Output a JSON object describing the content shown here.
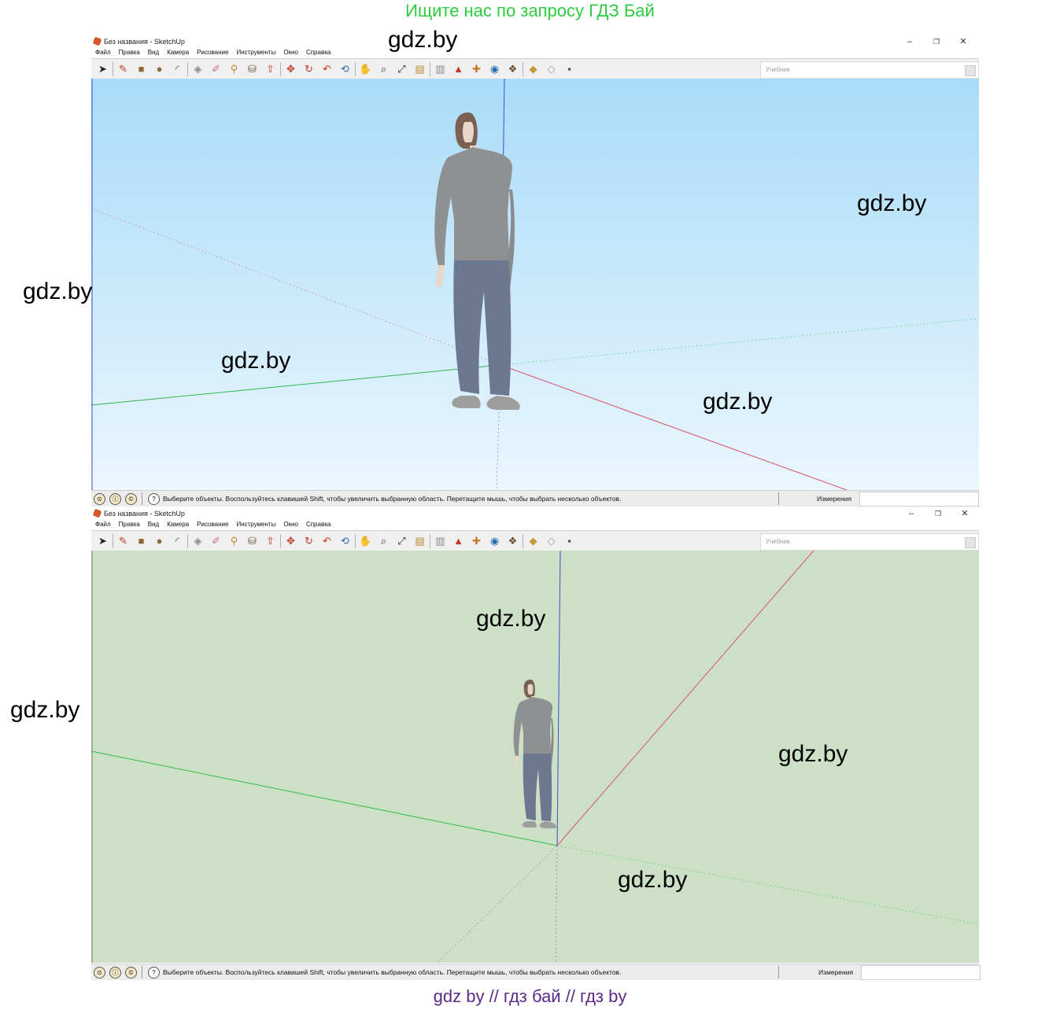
{
  "banner_top": "Ищите нас по запросу ГДЗ Бай",
  "banner_bottom": "gdz by  //  гдз бай  //  гдз by",
  "watermark": "gdz.by",
  "windows": [
    {
      "title": "Без названия - SketchUp",
      "menu": [
        "Файл",
        "Правка",
        "Вид",
        "Камера",
        "Рисование",
        "Инструменты",
        "Окно",
        "Справка"
      ],
      "search_placeholder": "Учебник",
      "status_text": "Выберите объекты. Воспользуйтесь клавишей Shift, чтобы увеличить выбранную область. Перетащите мышь, чтобы выбрать несколько объектов.",
      "measurements_label": "Измерения",
      "viewport_style": "sky-gradient"
    },
    {
      "title": "Без названия - SketchUp",
      "menu": [
        "Файл",
        "Правка",
        "Вид",
        "Камера",
        "Рисование",
        "Инструменты",
        "Окно",
        "Справка"
      ],
      "search_placeholder": "Учебник",
      "status_text": "Выберите объекты. Воспользуйтесь клавишей Shift, чтобы увеличить выбранную область. Перетащите мышь, чтобы выбрать несколько объектов.",
      "measurements_label": "Измерения",
      "viewport_style": "flat-green"
    }
  ],
  "window_controls": [
    "–",
    "❐",
    "✕"
  ],
  "colors": {
    "sky_top": "#a8dcf8",
    "sky_bottom": "#eaf7fe",
    "ground_green": "#cce0c6",
    "axis_red": "#d9536a",
    "axis_green": "#2fb84a",
    "axis_blue": "#3a4fcf",
    "banner_green": "#2ecc40",
    "banner_purple": "#5b2a86"
  },
  "toolbar_icons": [
    "select-arrow-icon",
    "pencil-line-icon",
    "rectangle-icon",
    "circle-icon",
    "arc-icon",
    "make-component-icon",
    "eraser-icon",
    "tape-measure-icon",
    "paint-bucket-icon",
    "push-pull-icon",
    "move-icon",
    "rotate-icon",
    "follow-me-icon",
    "orbit-icon",
    "pan-icon",
    "zoom-icon",
    "zoom-extents-icon",
    "warehouse-icon",
    "share-model-icon",
    "extension-warehouse-icon",
    "layout-icon",
    "style-builder-icon",
    "component-icon",
    "materials-icon",
    "styles-icon"
  ]
}
